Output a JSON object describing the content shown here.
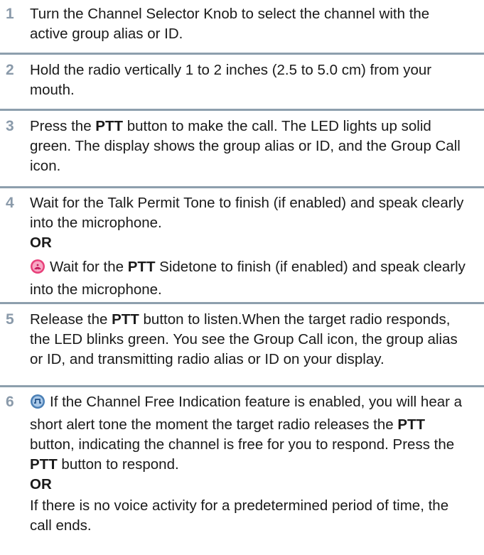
{
  "steps": [
    {
      "number": "1",
      "text": "Turn the Channel Selector Knob to select the channel with the active group alias or ID."
    },
    {
      "number": "2",
      "text": "Hold the radio vertically 1 to 2 inches (2.5 to 5.0 cm) from your mouth."
    },
    {
      "number": "3",
      "text_before": "Press the ",
      "bold": "PTT",
      "text_after": " button to make the call. The LED lights up solid green. The display shows the group alias or ID, and the Group Call icon."
    },
    {
      "number": "4",
      "text": "Wait for the Talk Permit Tone to finish (if enabled) and speak clearly into the microphone.",
      "or": "OR",
      "alt_before": "Wait for the ",
      "alt_bold": "PTT",
      "alt_after": " Sidetone to finish (if enabled) and speak clearly into the microphone.",
      "alt_icon": "sidetone-icon"
    },
    {
      "number": "5",
      "text_before": "Release the ",
      "bold": "PTT",
      "text_after": " button to listen.When the target radio responds, the LED blinks green. You see the Group Call icon, the group alias or ID, and transmitting radio alias or ID on your display."
    },
    {
      "number": "6",
      "icon": "channel-free-icon",
      "text_before": "If the Channel Free Indication feature is enabled, you will hear a short alert tone the moment the target radio releases the ",
      "bold": "PTT",
      "text_middle": " button, indicating the channel is free for you to respond. Press the ",
      "bold2": "PTT",
      "text_after": " button to respond.",
      "or": "OR",
      "alt_text": "If there is no voice activity for a predetermined period of time, the call ends."
    }
  ],
  "colors": {
    "step_number": "#8a9aaa",
    "separator": "#8d9fad",
    "sidetone_icon": "#e8407a",
    "channel_free_icon": "#4a7fb5"
  }
}
